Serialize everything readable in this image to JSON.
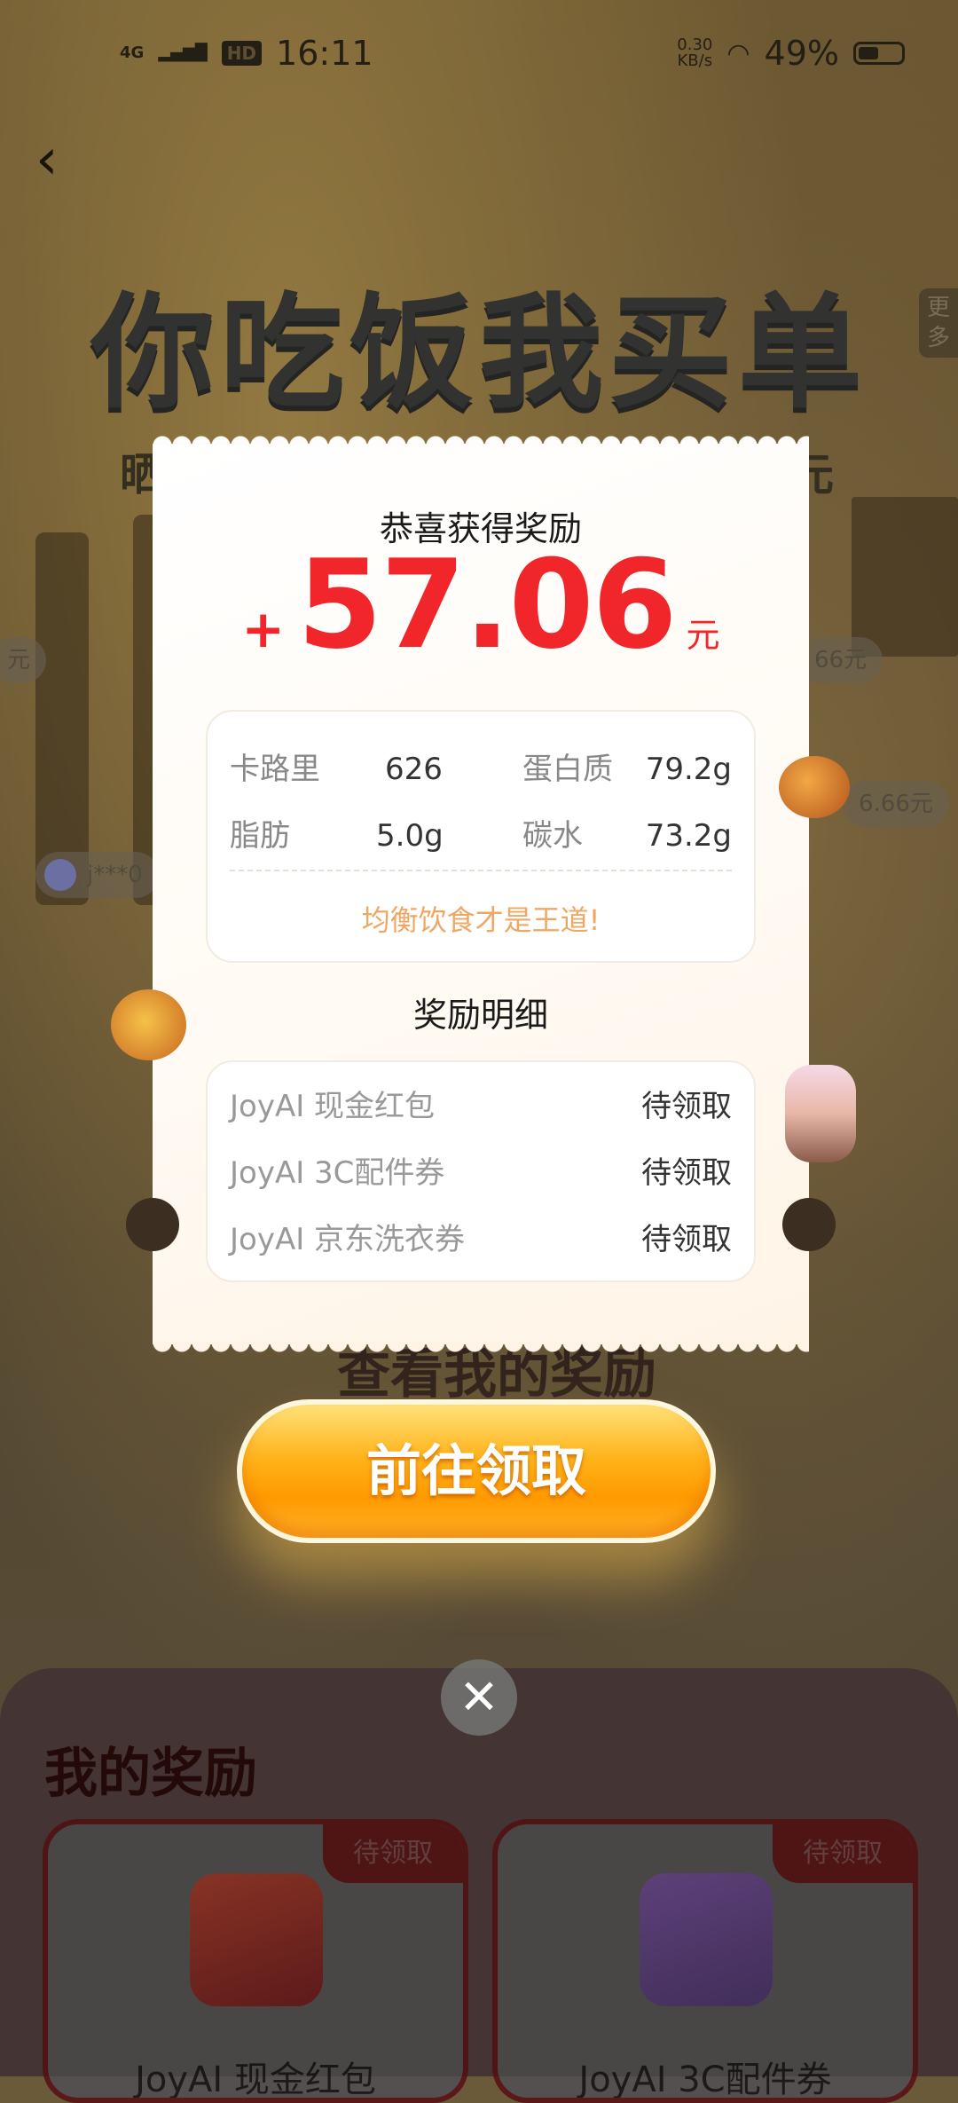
{
  "status_bar": {
    "network": "4G",
    "hd": "HD",
    "time": "16:11",
    "speed_top": "0.30",
    "speed_bottom": "KB/s",
    "battery": "49%",
    "battery_level": 0.49
  },
  "background": {
    "title": "你吃饭我买单",
    "more_label": "更多",
    "subtitle_left": "晒",
    "subtitle_right": "元",
    "pill_left": "元",
    "pill_right_1": "66元",
    "pill_right_2": "6.66元",
    "pill_user": "j***0",
    "behind_button_text": "查看我的奖励",
    "my_rewards_title": "我的奖励",
    "cards": [
      {
        "tag": "待领取",
        "name": "JoyAI 现金红包",
        "icon": "red-envelope-icon"
      },
      {
        "tag": "待领取",
        "name": "JoyAI 3C配件券",
        "icon": "earbuds-coupon-icon"
      }
    ]
  },
  "modal": {
    "congrats": "恭喜获得奖励",
    "amount_prefix": "+",
    "amount": "57.06",
    "amount_unit": "元",
    "nutrition": {
      "calorie_label": "卡路里",
      "calorie_value": "626",
      "protein_label": "蛋白质",
      "protein_value": "79.2g",
      "fat_label": "脂肪",
      "fat_value": "5.0g",
      "carb_label": "碳水",
      "carb_value": "73.2g"
    },
    "tip": "均衡饮食才是王道!",
    "detail_title": "奖励明细",
    "details": [
      {
        "name": "JoyAI 现金红包",
        "status": "待领取"
      },
      {
        "name": "JoyAI 3C配件券",
        "status": "待领取"
      },
      {
        "name": "JoyAI 京东洗衣券",
        "status": "待领取"
      }
    ],
    "button": "前往领取",
    "close_icon": "close-icon"
  },
  "colors": {
    "amount_red": "#f0262a",
    "tip_orange": "#efa864",
    "button_orange": "#ff9a00"
  }
}
